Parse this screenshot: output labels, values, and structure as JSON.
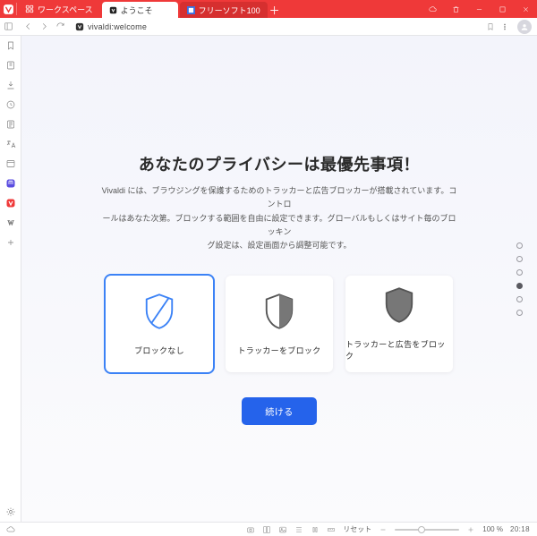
{
  "titlebar": {
    "workspace_label": "ワークスペース",
    "tabs": [
      {
        "label": "ようこそ",
        "active": true
      },
      {
        "label": "フリーソフト100",
        "active": false
      }
    ]
  },
  "addressbar": {
    "url": "vivaldi:welcome"
  },
  "welcome": {
    "heading": "あなたのプライバシーは最優先事項！",
    "description_line1": "Vivaldi には、ブラウジングを保護するためのトラッカーと広告ブロッカーが搭載されています。コントロ",
    "description_line2": "ールはあなた次第。ブロックする範囲を自由に設定できます。グローバルもしくはサイト毎のブロッキン",
    "description_line3": "グ設定は、設定画面から調整可能です。",
    "cards": {
      "none": "ブロックなし",
      "trackers": "トラッカーをブロック",
      "trackers_ads": "トラッカーと広告をブロック"
    },
    "continue_label": "続ける",
    "page_dots_total": 6,
    "page_dots_active_index": 3
  },
  "statusbar": {
    "reset_label": "リセット",
    "zoom_label": "100 %",
    "clock": "20:18"
  }
}
